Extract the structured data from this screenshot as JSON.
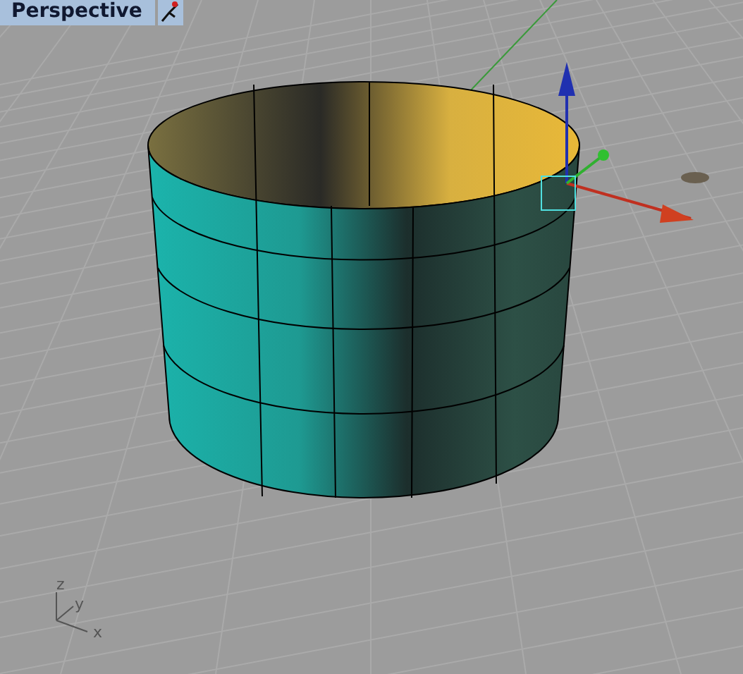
{
  "viewport": {
    "title": "Perspective"
  },
  "axis_triad": {
    "labels": [
      "z",
      "y",
      "x"
    ]
  }
}
